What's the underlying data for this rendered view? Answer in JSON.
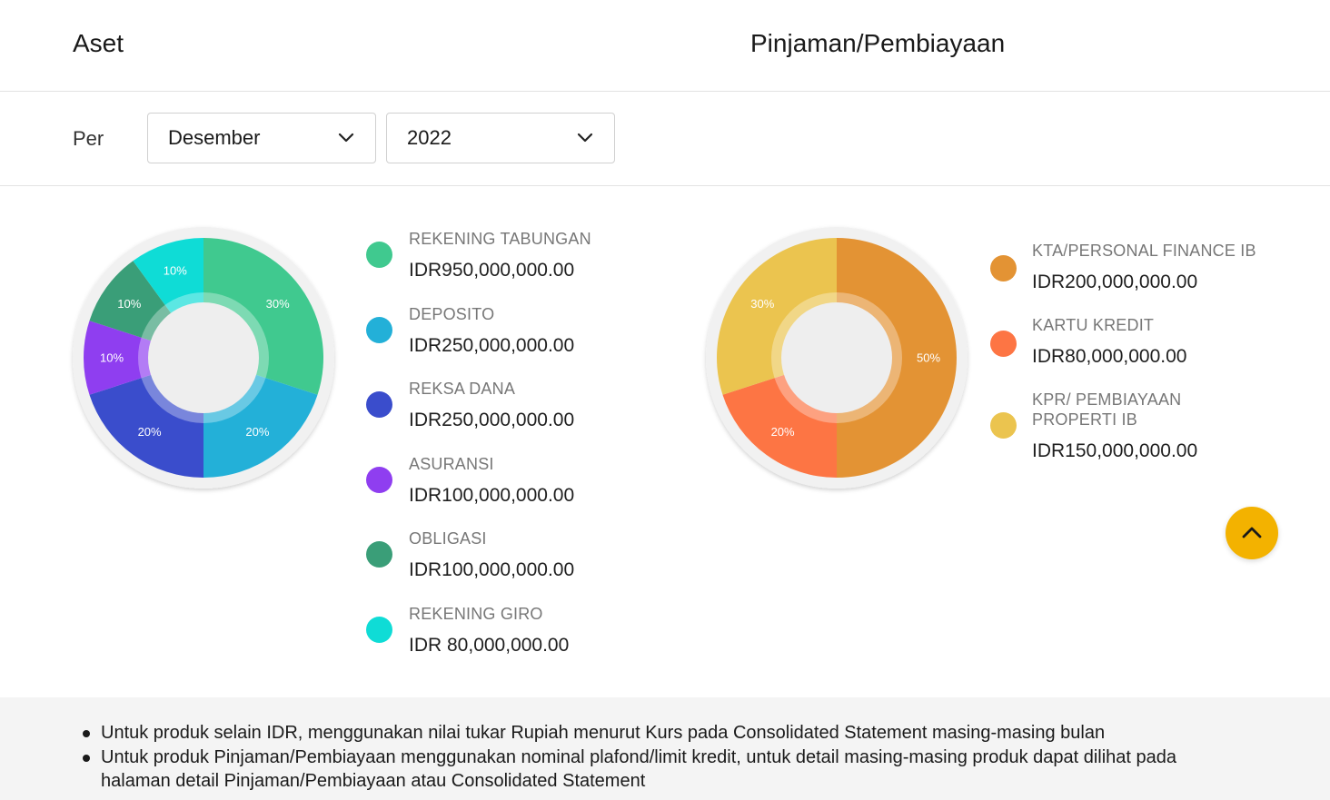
{
  "tabs": [
    {
      "label": "Aset"
    },
    {
      "label": "Pinjaman/Pembiayaan"
    }
  ],
  "filter": {
    "per_label": "Per",
    "month": "Desember",
    "year": "2022"
  },
  "chart_data": [
    {
      "type": "pie",
      "categories": [
        "REKENING TABUNGAN",
        "DEPOSITO",
        "REKSA DANA",
        "ASURANSI",
        "OBLIGASI",
        "REKENING GIRO"
      ],
      "values": [
        30,
        20,
        20,
        10,
        10,
        10
      ],
      "value_labels": [
        "30%",
        "20%",
        "20%",
        "10%",
        "10%",
        "10%"
      ],
      "colors": [
        "#40c98f",
        "#23b0d8",
        "#3a4dcc",
        "#8f3ef0",
        "#3a9e78",
        "#0fdcd6"
      ]
    },
    {
      "type": "pie",
      "categories": [
        "KTA/PERSONAL FINANCE IB",
        "KARTU KREDIT",
        "KPR/ PEMBIAYAAN PROPERTI IB"
      ],
      "values": [
        50,
        20,
        30
      ],
      "value_labels": [
        "50%",
        "20%",
        "30%"
      ],
      "colors": [
        "#e39334",
        "#fd7544",
        "#ebc44f"
      ]
    }
  ],
  "asset_legend": [
    {
      "name": "REKENING TABUNGAN",
      "value": "IDR950,000,000.00",
      "color": "#40c98f"
    },
    {
      "name": "DEPOSITO",
      "value": "IDR250,000,000.00",
      "color": "#23b0d8"
    },
    {
      "name": "REKSA DANA",
      "value": "IDR250,000,000.00",
      "color": "#3a4dcc"
    },
    {
      "name": "ASURANSI",
      "value": "IDR100,000,000.00",
      "color": "#8f3ef0"
    },
    {
      "name": "OBLIGASI",
      "value": "IDR100,000,000.00",
      "color": "#3a9e78"
    },
    {
      "name": "REKENING GIRO",
      "value": "IDR 80,000,000.00",
      "color": "#0fdcd6"
    }
  ],
  "loan_legend": [
    {
      "name": "KTA/PERSONAL FINANCE IB",
      "value": "IDR200,000,000.00",
      "color": "#e39334"
    },
    {
      "name": "KARTU KREDIT",
      "value": "IDR80,000,000.00",
      "color": "#fd7544"
    },
    {
      "name": "KPR/ PEMBIAYAAN PROPERTI IB",
      "value": "IDR150,000,000.00",
      "color": "#ebc44f"
    }
  ],
  "notes": [
    "Untuk produk selain IDR, menggunakan nilai tukar Rupiah menurut Kurs pada Consolidated Statement masing-masing bulan",
    "Untuk produk Pinjaman/Pembiayaan menggunakan nominal plafond/limit kredit, untuk detail masing-masing produk dapat dilihat pada halaman detail Pinjaman/Pembiayaan atau Consolidated Statement"
  ],
  "icons": {
    "dropdown": "chevron-down-icon",
    "scroll_top": "chevron-up-icon"
  },
  "colors": {
    "accent": "#f3b200"
  }
}
